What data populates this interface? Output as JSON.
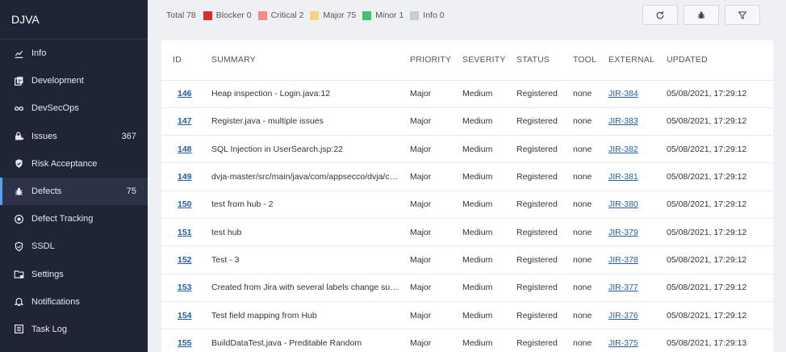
{
  "app": {
    "title": "DJVA"
  },
  "sidebar": {
    "items": [
      {
        "label": "Info",
        "icon": "chart-icon",
        "count": ""
      },
      {
        "label": "Development",
        "icon": "development-icon",
        "count": ""
      },
      {
        "label": "DevSecOps",
        "icon": "infinity-icon",
        "count": ""
      },
      {
        "label": "Issues",
        "icon": "lock-icon",
        "count": "367"
      },
      {
        "label": "Risk Acceptance",
        "icon": "shield-check-icon",
        "count": ""
      },
      {
        "label": "Defects",
        "icon": "bug-icon",
        "count": "75",
        "active": true
      },
      {
        "label": "Defect Tracking",
        "icon": "target-icon",
        "count": ""
      },
      {
        "label": "SSDL",
        "icon": "shield-icon",
        "count": ""
      },
      {
        "label": "Settings",
        "icon": "folder-gear-icon",
        "count": ""
      },
      {
        "label": "Notifications",
        "icon": "bell-icon",
        "count": ""
      },
      {
        "label": "Task Log",
        "icon": "list-icon",
        "count": ""
      }
    ]
  },
  "summary": {
    "total": "Total 78",
    "items": [
      {
        "label": "Blocker 0",
        "color": "#d32f2f"
      },
      {
        "label": "Critical 2",
        "color": "#f48a8a"
      },
      {
        "label": "Major 75",
        "color": "#f7d37a"
      },
      {
        "label": "Minor 1",
        "color": "#3cc46a"
      },
      {
        "label": "Info 0",
        "color": "#c9cdd2"
      }
    ]
  },
  "toolbar": {
    "buttons": [
      "refresh-icon",
      "bug-icon",
      "filter-icon"
    ]
  },
  "table": {
    "headers": [
      "ID",
      "SUMMARY",
      "PRIORITY",
      "SEVERITY",
      "STATUS",
      "TOOL",
      "EXTERNAL",
      "UPDATED"
    ],
    "rows": [
      {
        "id": "146",
        "summary": "Heap inspection - Login.java:12",
        "priority": "Major",
        "severity": "Medium",
        "status": "Registered",
        "tool": "none",
        "external": "JIR-384",
        "updated": "05/08/2021, 17:29:12"
      },
      {
        "id": "147",
        "summary": "Register.java - multiple issues",
        "priority": "Major",
        "severity": "Medium",
        "status": "Registered",
        "tool": "none",
        "external": "JIR-383",
        "updated": "05/08/2021, 17:29:12"
      },
      {
        "id": "148",
        "summary": "SQL Injection in UserSearch.jsp:22",
        "priority": "Major",
        "severity": "Medium",
        "status": "Registered",
        "tool": "none",
        "external": "JIR-382",
        "updated": "05/08/2021, 17:29:12"
      },
      {
        "id": "149",
        "summary": "dvja-master/src/main/java/com/appsecco/dvja/co...",
        "priority": "Major",
        "severity": "Medium",
        "status": "Registered",
        "tool": "none",
        "external": "JIR-381",
        "updated": "05/08/2021, 17:29:12"
      },
      {
        "id": "150",
        "summary": "test from hub - 2",
        "priority": "Major",
        "severity": "Medium",
        "status": "Registered",
        "tool": "none",
        "external": "JIR-380",
        "updated": "05/08/2021, 17:29:12"
      },
      {
        "id": "151",
        "summary": "test hub",
        "priority": "Major",
        "severity": "Medium",
        "status": "Registered",
        "tool": "none",
        "external": "JIR-379",
        "updated": "05/08/2021, 17:29:12"
      },
      {
        "id": "152",
        "summary": "Test - 3",
        "priority": "Major",
        "severity": "Medium",
        "status": "Registered",
        "tool": "none",
        "external": "JIR-378",
        "updated": "05/08/2021, 17:29:12"
      },
      {
        "id": "153",
        "summary": "Created from Jira with several labels change summ...",
        "priority": "Major",
        "severity": "Medium",
        "status": "Registered",
        "tool": "none",
        "external": "JIR-377",
        "updated": "05/08/2021, 17:29:12"
      },
      {
        "id": "154",
        "summary": "Test field mapping from Hub",
        "priority": "Major",
        "severity": "Medium",
        "status": "Registered",
        "tool": "none",
        "external": "JIR-376",
        "updated": "05/08/2021, 17:29:12"
      },
      {
        "id": "155",
        "summary": "BuildDataTest.java - Preditable Random",
        "priority": "Major",
        "severity": "Medium",
        "status": "Registered",
        "tool": "none",
        "external": "JIR-375",
        "updated": "05/08/2021, 17:29:13"
      }
    ]
  }
}
